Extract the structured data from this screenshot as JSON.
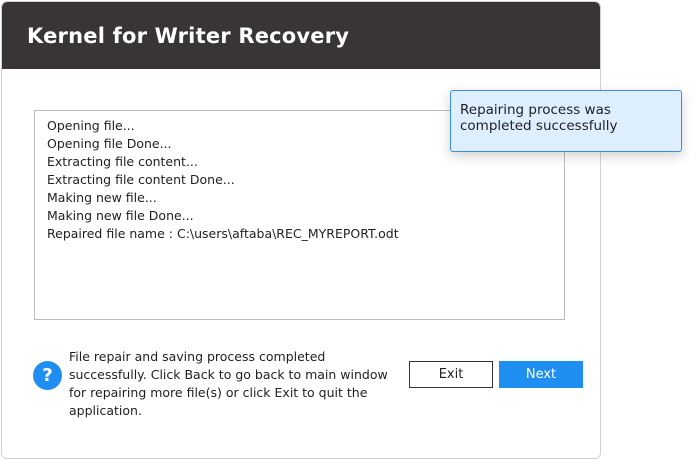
{
  "window": {
    "title": "Kernel for Writer Recovery"
  },
  "log": {
    "lines": [
      "Opening file...",
      "Opening file Done...",
      "Extracting file content...",
      "Extracting file content Done...",
      "Making new file...",
      "Making new file Done...",
      "Repaired file name : C:\\users\\aftaba\\REC_MYREPORT.odt"
    ]
  },
  "footer": {
    "help_icon_glyph": "?",
    "status_message": "File repair and saving process completed successfully. Click Back to go back to main window for repairing more file(s) or click Exit to quit the application.",
    "exit_label": "Exit",
    "next_label": "Next"
  },
  "notification": {
    "message": "Repairing process was completed successfully"
  },
  "colors": {
    "titlebar": "#3a3535",
    "accent": "#1e8ff0",
    "toast_bg": "#ddeeff",
    "toast_border": "#3b8ee0"
  }
}
